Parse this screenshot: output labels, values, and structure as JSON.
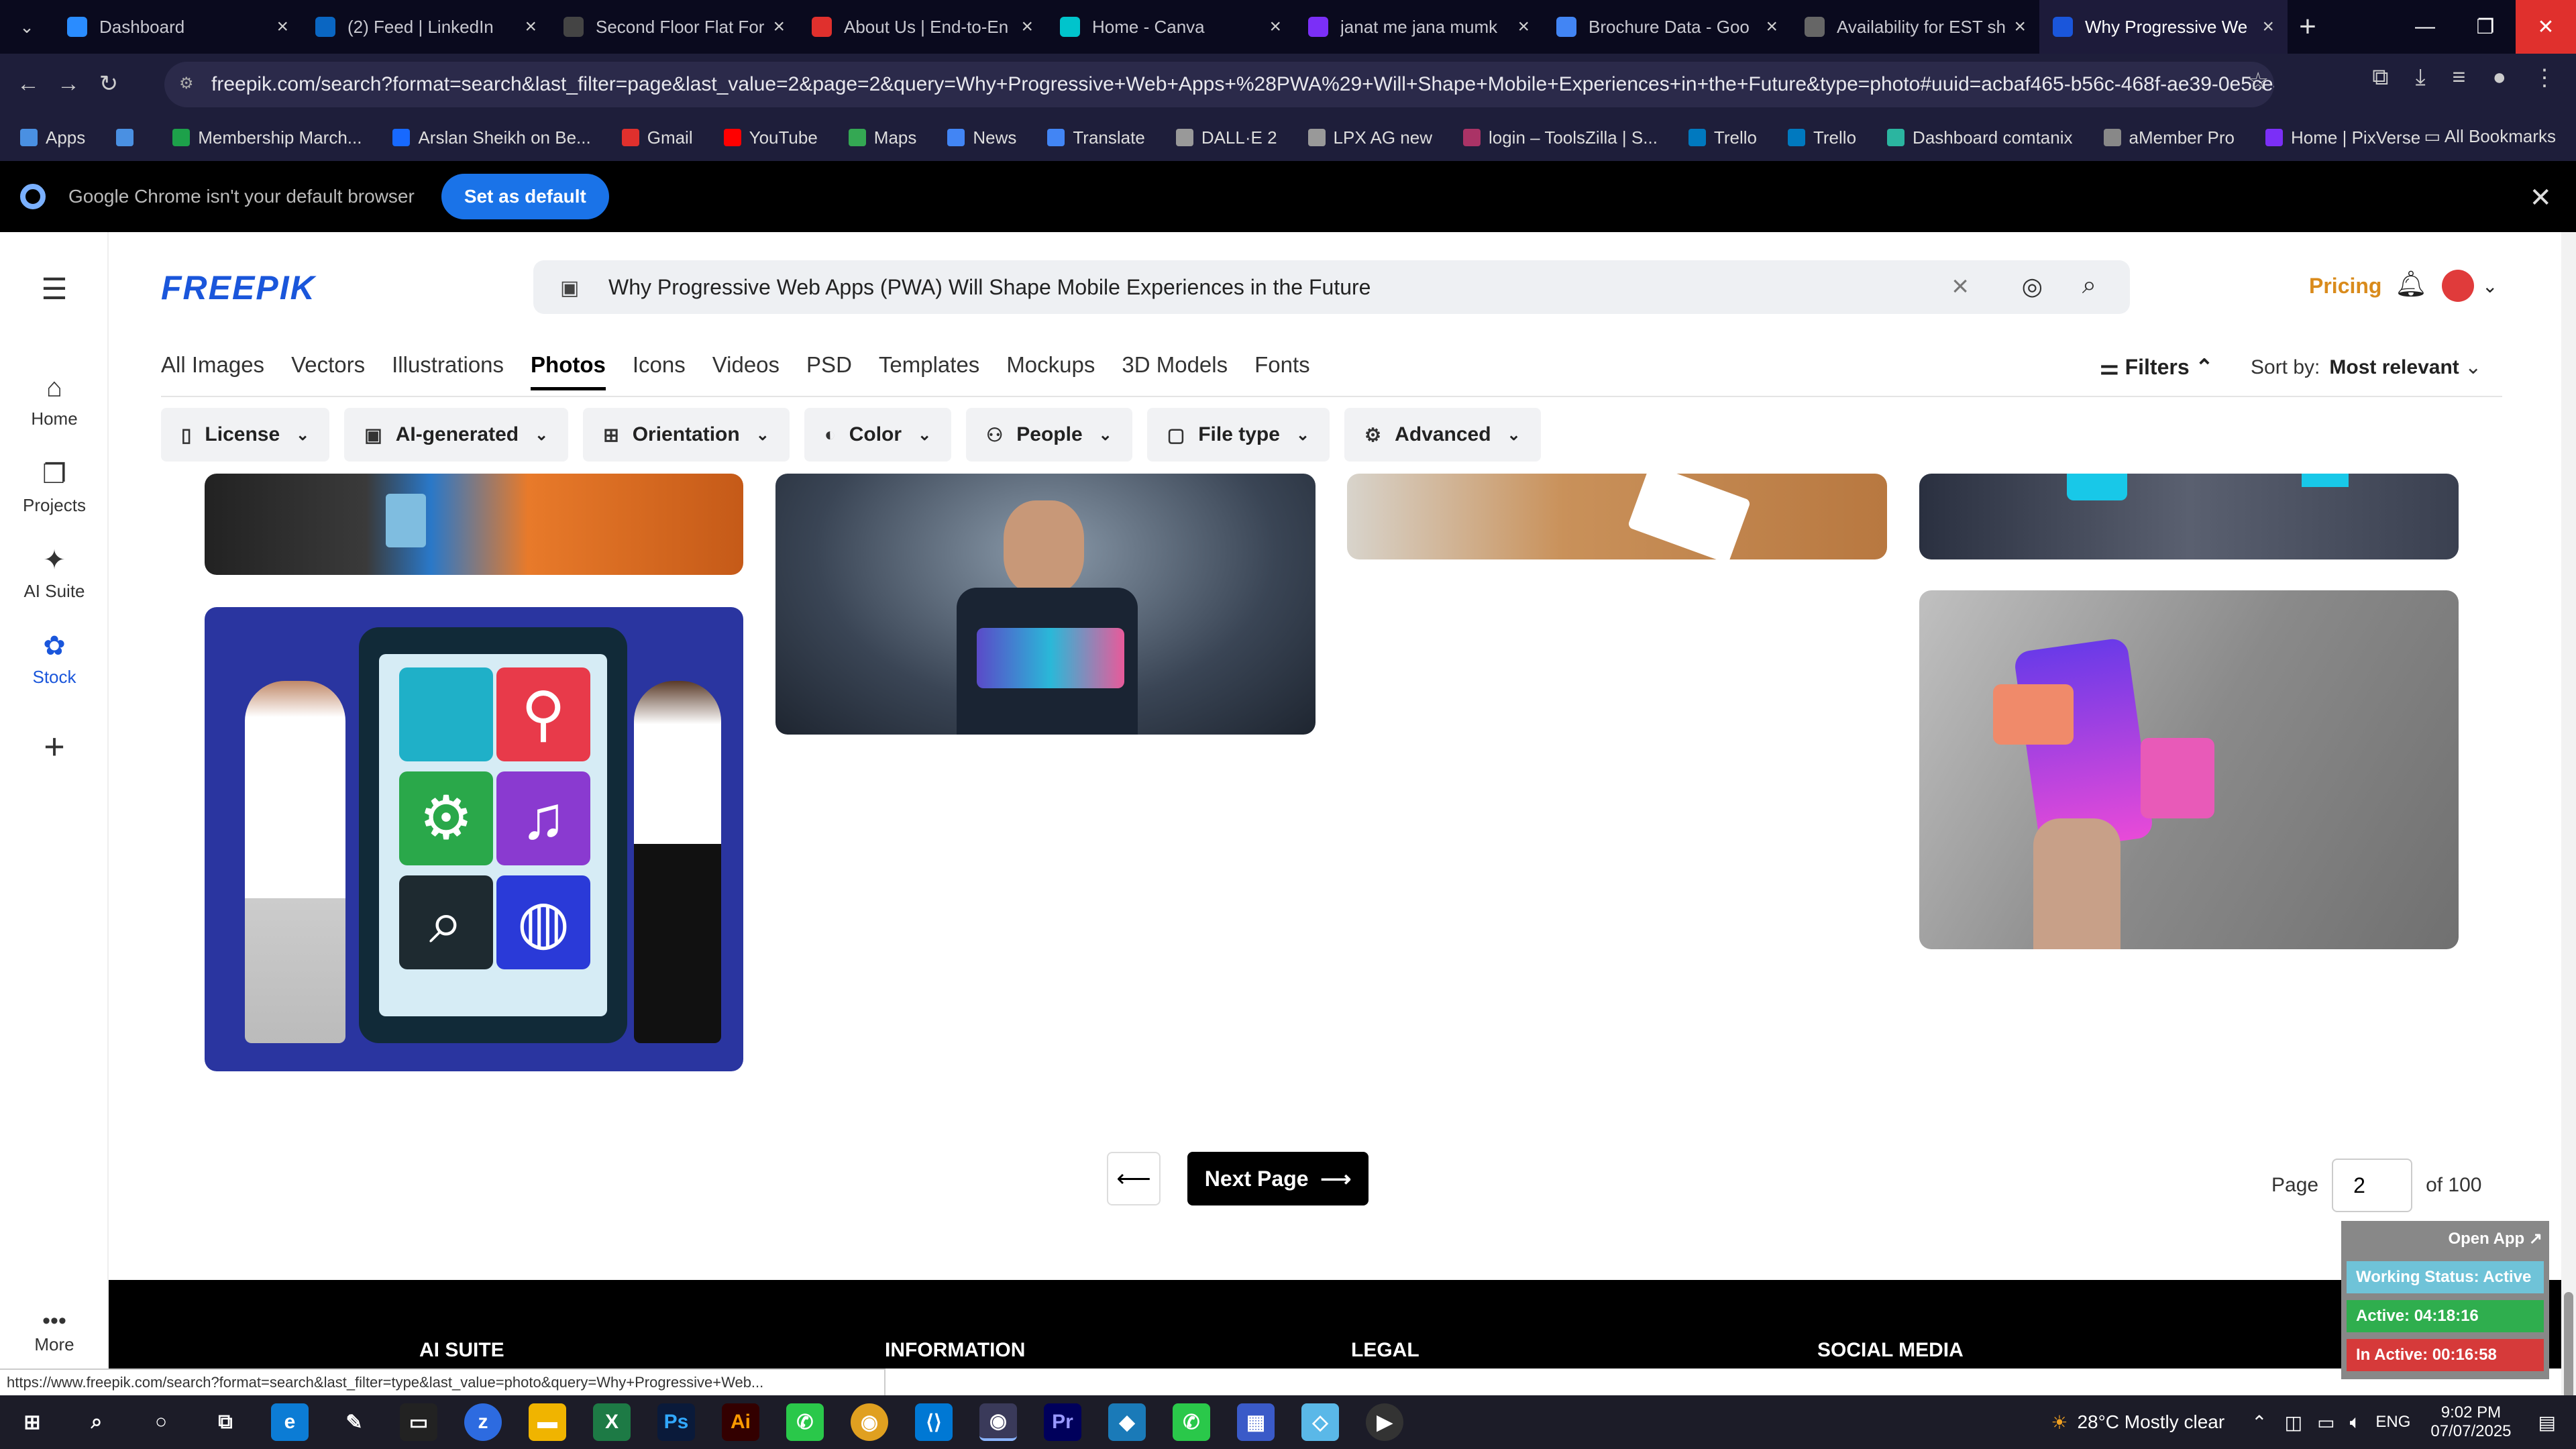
{
  "browser": {
    "tabs": [
      {
        "title": "Dashboard",
        "color": "#2a8cff",
        "active": false
      },
      {
        "title": "(2) Feed | LinkedIn",
        "color": "#0a66c2",
        "active": false
      },
      {
        "title": "Second Floor Flat For",
        "color": "#444444",
        "active": false
      },
      {
        "title": "About Us | End-to-En",
        "color": "#e0302d",
        "active": false
      },
      {
        "title": "Home - Canva",
        "color": "#00c4cc",
        "active": false
      },
      {
        "title": "janat me jana mumk",
        "color": "#7b2ff7",
        "active": false
      },
      {
        "title": "Brochure Data - Goo",
        "color": "#4285f4",
        "active": false
      },
      {
        "title": "Availability for EST sh",
        "color": "#666666",
        "active": false
      },
      {
        "title": "Why Progressive We",
        "color": "#1a56db",
        "active": true
      }
    ],
    "url": "freepik.com/search?format=search&last_filter=page&last_value=2&page=2&query=Why+Progressive+Web+Apps+%28PWA%29+Will+Shape+Mobile+Experiences+in+the+Future&type=photo#uuid=acbaf465-b56c-468f-ae39-0e5ce401c466",
    "bookmarks": [
      {
        "label": "Apps",
        "color": "#4a90e2"
      },
      {
        "label": "",
        "color": "#4a90e2"
      },
      {
        "label": "Membership March...",
        "color": "#1da14a"
      },
      {
        "label": "Arslan Sheikh on Be...",
        "color": "#1769ff"
      },
      {
        "label": "Gmail",
        "color": "#e0302d"
      },
      {
        "label": "YouTube",
        "color": "#ff0000"
      },
      {
        "label": "Maps",
        "color": "#34a853"
      },
      {
        "label": "News",
        "color": "#4285f4"
      },
      {
        "label": "Translate",
        "color": "#4285f4"
      },
      {
        "label": "DALL·E 2",
        "color": "#999999"
      },
      {
        "label": "LPX AG new",
        "color": "#999999"
      },
      {
        "label": "login – ToolsZilla | S...",
        "color": "#aa3366"
      },
      {
        "label": "Trello",
        "color": "#0079bf"
      },
      {
        "label": "Trello",
        "color": "#0079bf"
      },
      {
        "label": "Dashboard comtanix",
        "color": "#2bb5a0"
      },
      {
        "label": "aMember Pro",
        "color": "#888888"
      },
      {
        "label": "Home | PixVerse",
        "color": "#7b2ff7"
      }
    ],
    "all_bookmarks": "All Bookmarks",
    "infobar_text": "Google Chrome isn't your default browser",
    "set_default": "Set as default",
    "status_url": "https://www.freepik.com/search?format=search&last_filter=type&last_value=photo&query=Why+Progressive+Web..."
  },
  "sidebar": {
    "items": [
      {
        "label": "Home",
        "icon": "home-icon"
      },
      {
        "label": "Projects",
        "icon": "projects-icon"
      },
      {
        "label": "AI Suite",
        "icon": "sparkle-icon"
      },
      {
        "label": "Stock",
        "icon": "stock-icon"
      }
    ],
    "more": "More"
  },
  "header": {
    "logo": "FREEPIK",
    "search_value": "Why Progressive Web Apps (PWA) Will Shape Mobile Experiences in the Future",
    "pricing": "Pricing"
  },
  "categories": [
    "All Images",
    "Vectors",
    "Illustrations",
    "Photos",
    "Icons",
    "Videos",
    "PSD",
    "Templates",
    "Mockups",
    "3D Models",
    "Fonts"
  ],
  "active_category": "Photos",
  "filters_label": "Filters",
  "sort_label": "Sort by:",
  "sort_value": "Most relevant",
  "chips": [
    {
      "label": "License",
      "icon": "license-icon"
    },
    {
      "label": "AI-generated",
      "icon": "ai-icon"
    },
    {
      "label": "Orientation",
      "icon": "orientation-icon"
    },
    {
      "label": "Color",
      "icon": "palette-icon"
    },
    {
      "label": "People",
      "icon": "people-icon"
    },
    {
      "label": "File type",
      "icon": "file-icon"
    },
    {
      "label": "Advanced",
      "icon": "settings-icon"
    }
  ],
  "pagination": {
    "next": "Next Page",
    "page_label": "Page",
    "page_value": "2",
    "of_label": "of 100"
  },
  "footer": {
    "headings": [
      "AI SUITE",
      "INFORMATION",
      "LEGAL",
      "SOCIAL MEDIA"
    ]
  },
  "tracker": {
    "open_app": "Open App ↗",
    "working": "Working Status: Active",
    "active": "Active: 04:18:16",
    "inactive": "In Active: 00:16:58"
  },
  "taskbar": {
    "weather": "28°C",
    "weather_desc": "Mostly clear",
    "lang": "ENG",
    "time": "9:02 PM",
    "date": "07/07/2025"
  }
}
